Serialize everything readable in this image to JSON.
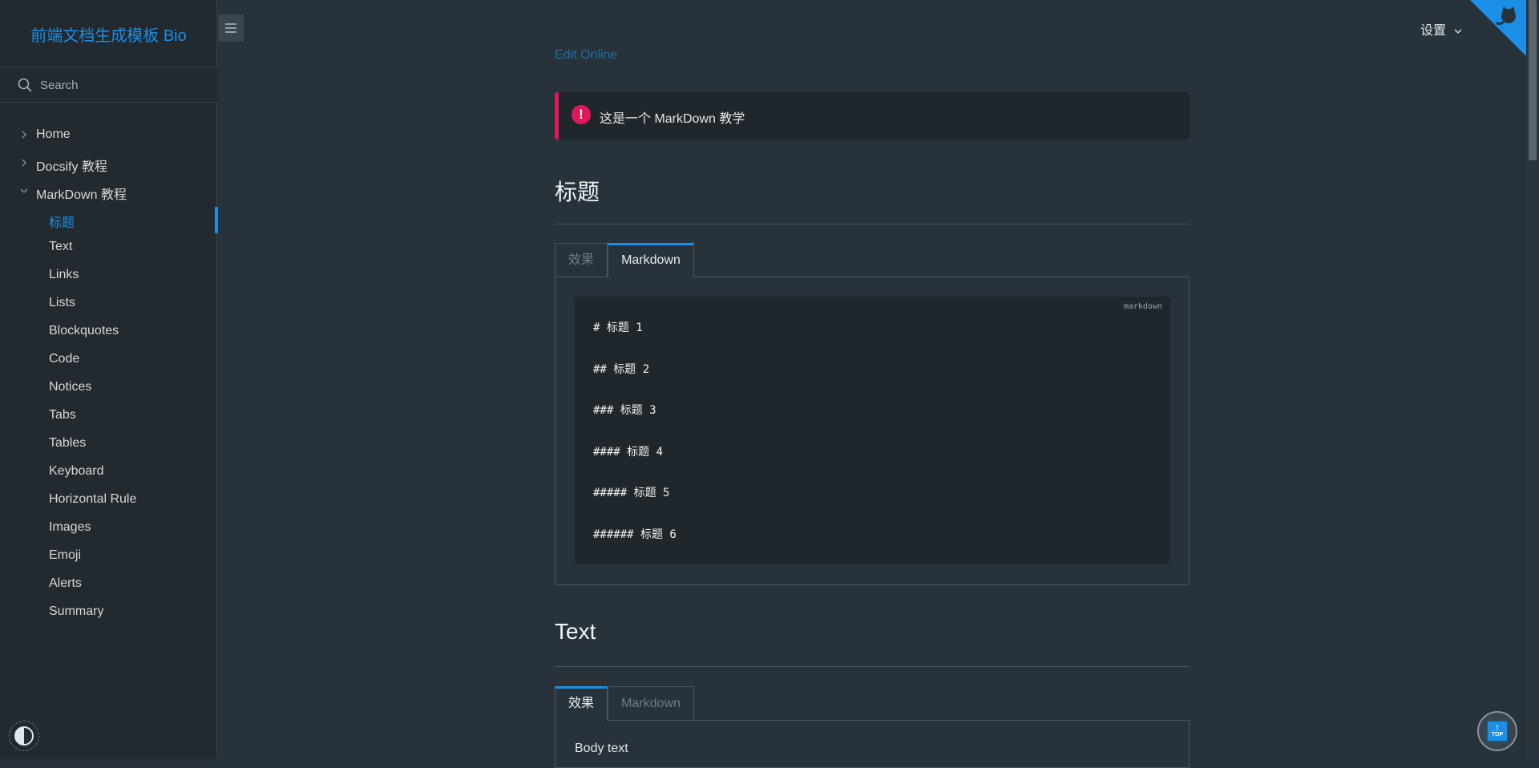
{
  "sidebar": {
    "app_name": "前端文档生成模板 Bio",
    "search_placeholder": "Search",
    "nav": [
      {
        "label": "Home",
        "expanded": false
      },
      {
        "label": "Docsify 教程",
        "expanded": false
      },
      {
        "label": "MarkDown 教程",
        "expanded": true
      }
    ],
    "subnav": [
      {
        "label": "标题",
        "active": true
      },
      {
        "label": "Text"
      },
      {
        "label": "Links"
      },
      {
        "label": "Lists"
      },
      {
        "label": "Blockquotes"
      },
      {
        "label": "Code"
      },
      {
        "label": "Notices"
      },
      {
        "label": "Tabs"
      },
      {
        "label": "Tables"
      },
      {
        "label": "Keyboard"
      },
      {
        "label": "Horizontal Rule"
      },
      {
        "label": "Images"
      },
      {
        "label": "Emoji"
      },
      {
        "label": "Alerts"
      },
      {
        "label": "Summary"
      }
    ]
  },
  "header": {
    "settings_label": "设置"
  },
  "content": {
    "edit_online": "Edit Online",
    "notice": "这是一个 MarkDown 教学",
    "section1": {
      "title": "标题",
      "tabs": [
        "效果",
        "Markdown"
      ],
      "active_tab": "Markdown",
      "code_lang": "markdown",
      "code_lines": [
        "# 标题 1",
        "## 标题 2",
        "### 标题 3",
        "#### 标题 4",
        "##### 标题 5",
        "###### 标题 6"
      ]
    },
    "section2": {
      "title": "Text",
      "tabs": [
        "效果",
        "Markdown"
      ],
      "active_tab": "效果",
      "body_text": "Body text"
    }
  },
  "back_to_top_label": "TOP",
  "colors": {
    "accent": "#1b8fe6",
    "notice": "#e0185b",
    "background": "#27323a",
    "sidebar": "#22292f"
  }
}
